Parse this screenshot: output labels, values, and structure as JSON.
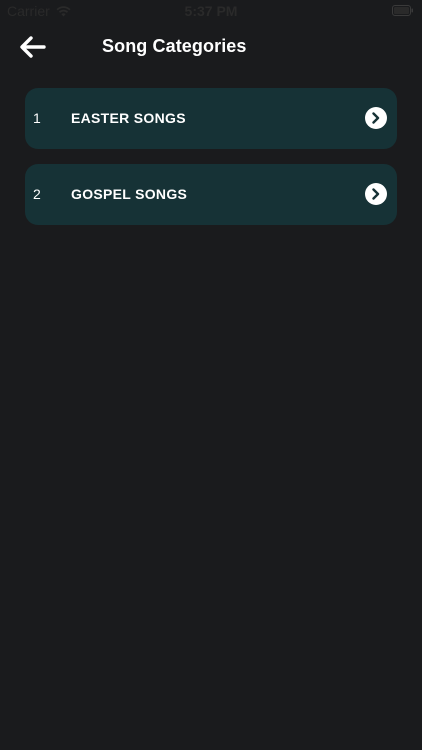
{
  "status_bar": {
    "carrier": "Carrier",
    "time": "5:37 PM"
  },
  "header": {
    "back_icon": "arrow-left-icon",
    "title": "Song Categories"
  },
  "categories": [
    {
      "index": "1",
      "label": "EASTER SONGS",
      "icon": "chevron-right-circle-icon"
    },
    {
      "index": "2",
      "label": "GOSPEL SONGS",
      "icon": "chevron-right-circle-icon"
    }
  ],
  "colors": {
    "background": "#1a1b1d",
    "card": "#163236",
    "text": "#ffffff"
  }
}
